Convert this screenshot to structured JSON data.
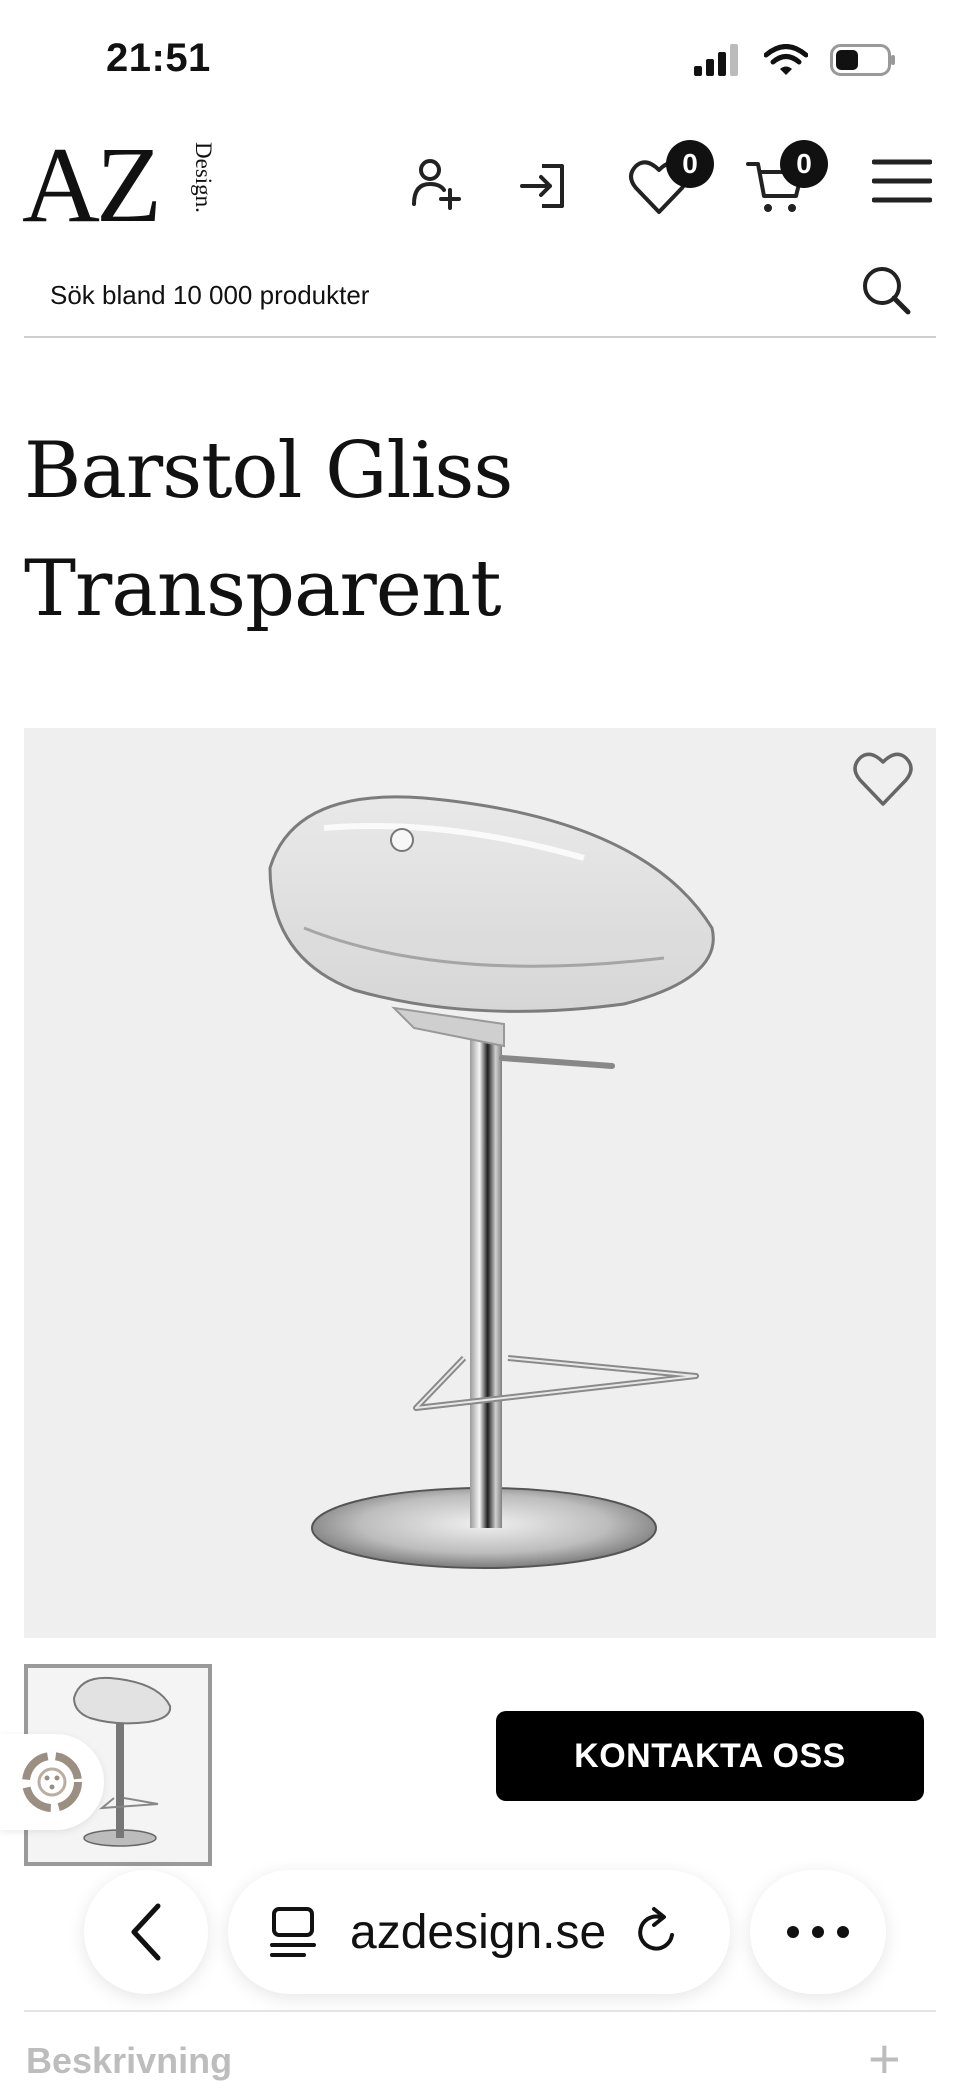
{
  "status_bar": {
    "time": "21:51"
  },
  "header": {
    "logo_main": "AZ",
    "logo_sub": "Design.",
    "wishlist_count": "0",
    "cart_count": "0"
  },
  "search": {
    "placeholder": "Sök bland 10 000 produkter"
  },
  "product": {
    "title_line1": "Barstol Gliss",
    "title_line2": "Transparent",
    "contact_label": "KONTAKTA OSS"
  },
  "browser": {
    "url": "azdesign.se"
  },
  "description": {
    "label": "Beskrivning",
    "expand_symbol": "+"
  }
}
